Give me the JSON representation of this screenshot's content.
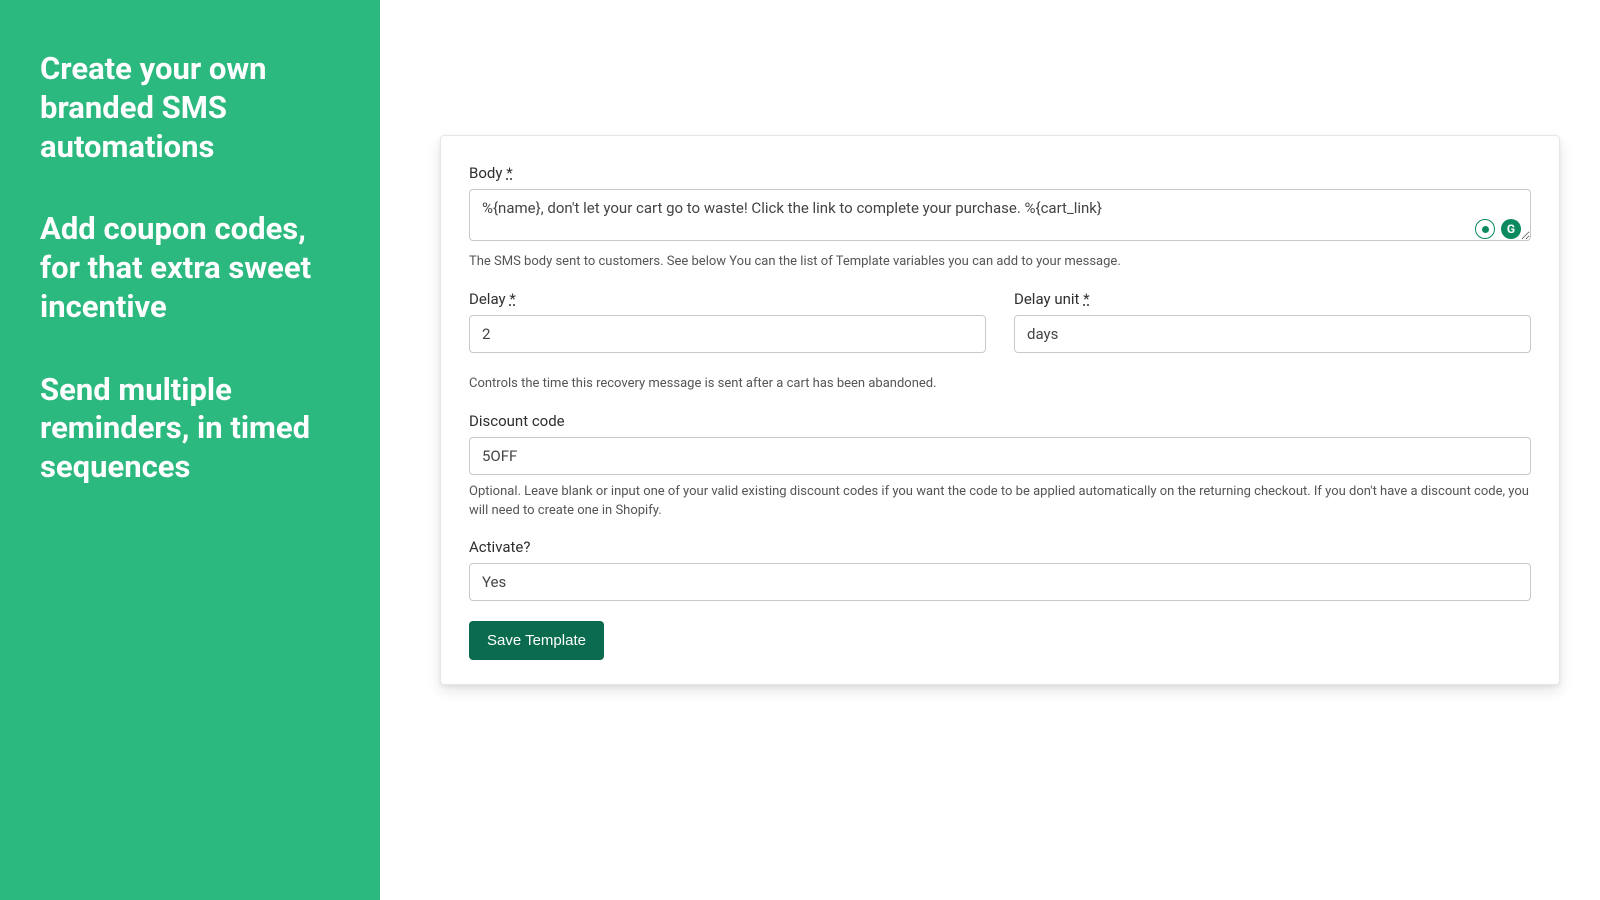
{
  "promo": {
    "line1": "Create your own branded SMS automations",
    "line2": "Add coupon codes, for that extra sweet incentive",
    "line3": "Send multiple reminders, in timed sequences"
  },
  "form": {
    "body": {
      "label": "Body",
      "required_mark": "*",
      "value": "%{name}, don't let your cart go to waste! Click the link to complete your purchase. %{cart_link}",
      "helper": "The SMS body sent to customers. See below You can the list of Template variables you can add to your message."
    },
    "delay": {
      "label": "Delay",
      "required_mark": "*",
      "value": "2"
    },
    "delay_unit": {
      "label": "Delay unit",
      "required_mark": "*",
      "value": "days"
    },
    "delay_helper": "Controls the time this recovery message is sent after a cart has been abandoned.",
    "discount": {
      "label": "Discount code",
      "value": "5OFF",
      "helper": "Optional. Leave blank or input one of your valid existing discount codes if you want the code to be applied automatically on the returning checkout. If you don't have a discount code, you will need to create one in Shopify."
    },
    "activate": {
      "label": "Activate?",
      "value": "Yes"
    },
    "save_label": "Save Template",
    "grammarly_letter": "G"
  }
}
